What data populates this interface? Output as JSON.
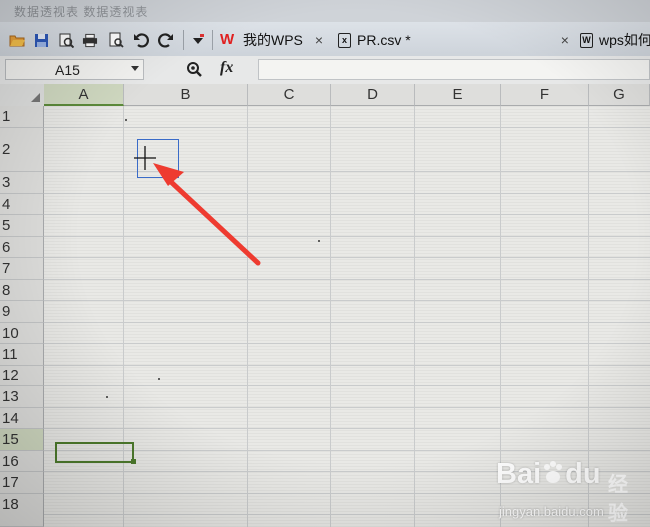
{
  "title_strip": {
    "text": "数据透视表  数据透视表"
  },
  "toolbar": {
    "icons": [
      "folder-open-icon",
      "save-icon",
      "print-preview-icon",
      "print-icon",
      "find-icon",
      "undo-icon",
      "redo-icon",
      "dropdown-icon"
    ],
    "tabs": [
      {
        "label": "我的WPS",
        "icon": "wps-logo-icon",
        "close": "×"
      },
      {
        "label": "PR.csv *",
        "icon": "spreadsheet-icon",
        "close": "×"
      },
      {
        "label": "wps如何",
        "icon": "document-icon"
      }
    ]
  },
  "formula_bar": {
    "name_box": "A15",
    "fx": "fx",
    "formula": ""
  },
  "sheet": {
    "columns": [
      "A",
      "B",
      "C",
      "D",
      "E",
      "F",
      "G"
    ],
    "rows": [
      "1",
      "2",
      "3",
      "4",
      "5",
      "6",
      "7",
      "8",
      "9",
      "10",
      "11",
      "12",
      "13",
      "14",
      "15",
      "16",
      "17",
      "18"
    ],
    "active_cell": "A15",
    "colors": {
      "selection": "#4d7a2c",
      "highlight_box": "#3a6bc8",
      "arrow": "#ee3b30"
    }
  },
  "watermark": {
    "brand": "Bai",
    "brand_suffix": "du",
    "service": "经验",
    "url": "jingyan.baidu.com"
  }
}
